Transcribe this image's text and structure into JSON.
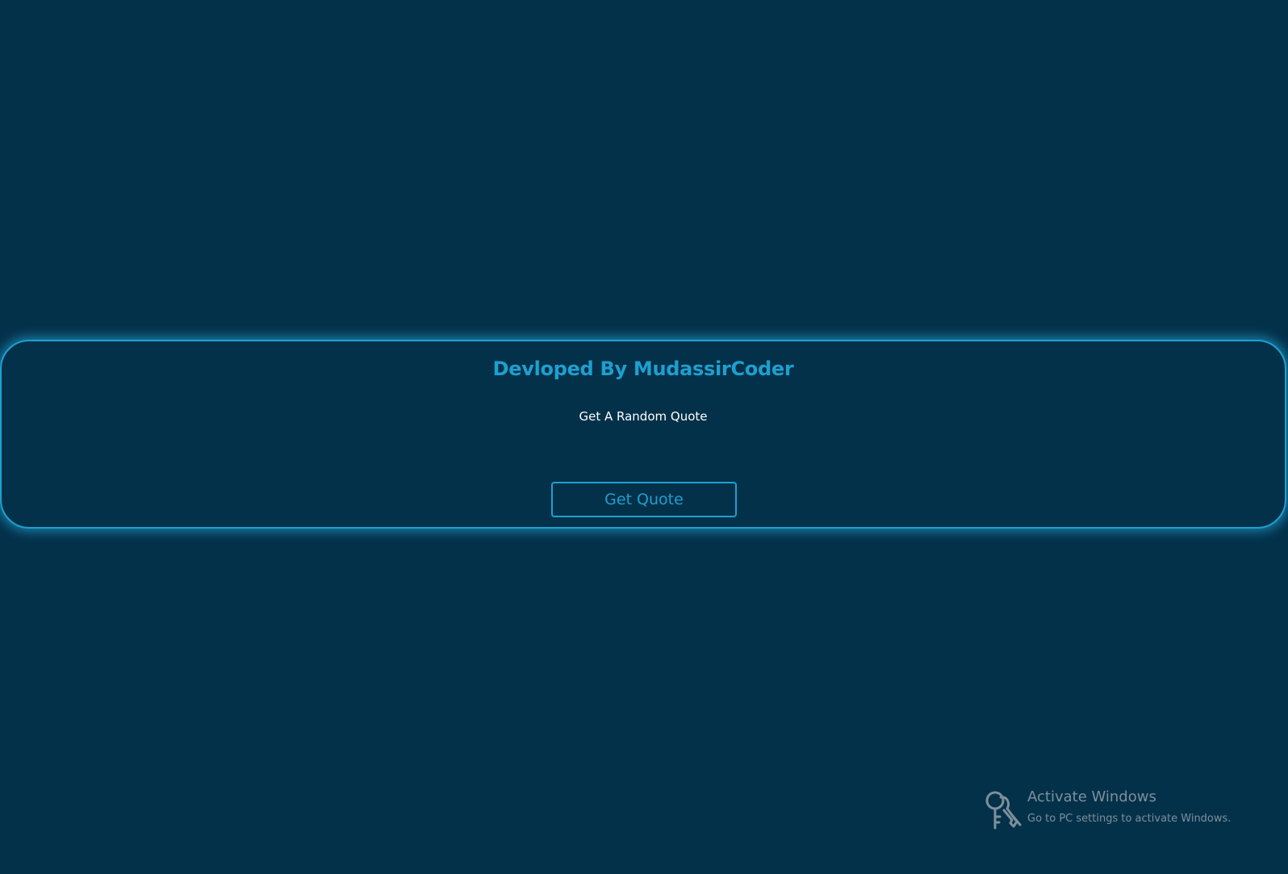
{
  "card": {
    "title": "Devloped By MudassirCoder",
    "quote": "Get A Random Quote",
    "button_label": "Get Quote"
  },
  "watermark": {
    "title": "Activate Windows",
    "subtitle": "Go to PC settings to activate Windows.",
    "icon": "keys-icon"
  },
  "colors": {
    "background": "#04314a",
    "accent": "#1f9fcf",
    "quote_text": "#ffffff",
    "watermark_text": "#7d8f9b"
  }
}
